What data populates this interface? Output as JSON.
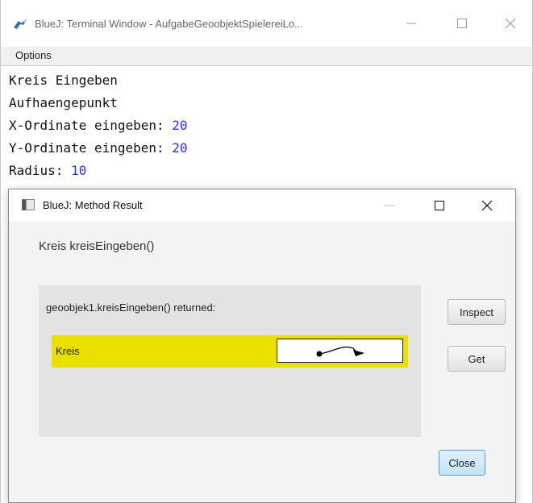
{
  "terminal": {
    "title": "BlueJ: Terminal Window - AufgabeGeoobjektSpielereiLo...",
    "menu": [
      "Options"
    ],
    "lines": [
      {
        "text": "Kreis Eingeben",
        "input": ""
      },
      {
        "text": "Aufhaengepunkt",
        "input": ""
      },
      {
        "text": "X-Ordinate eingeben: ",
        "input": "20"
      },
      {
        "text": "Y-Ordinate eingeben: ",
        "input": "20"
      },
      {
        "text": "Radius: ",
        "input": "10"
      }
    ],
    "input_color": "#2b31e0"
  },
  "dialog": {
    "title": "BlueJ:  Method Result",
    "method_signature": "Kreis kreisEingeben()",
    "result_label": "geoobjek1.kreisEingeben() returned:",
    "result_type": "Kreis",
    "highlight_color": "#e9e000",
    "inspect_label": "Inspect",
    "get_label": "Get",
    "close_label": "Close"
  },
  "icons": {
    "app": "bluej-bird-icon",
    "dialog": "window-icon",
    "minimize": "minimize-icon",
    "maximize": "maximize-icon",
    "close": "close-icon",
    "reference": "object-reference-arrow-icon"
  }
}
